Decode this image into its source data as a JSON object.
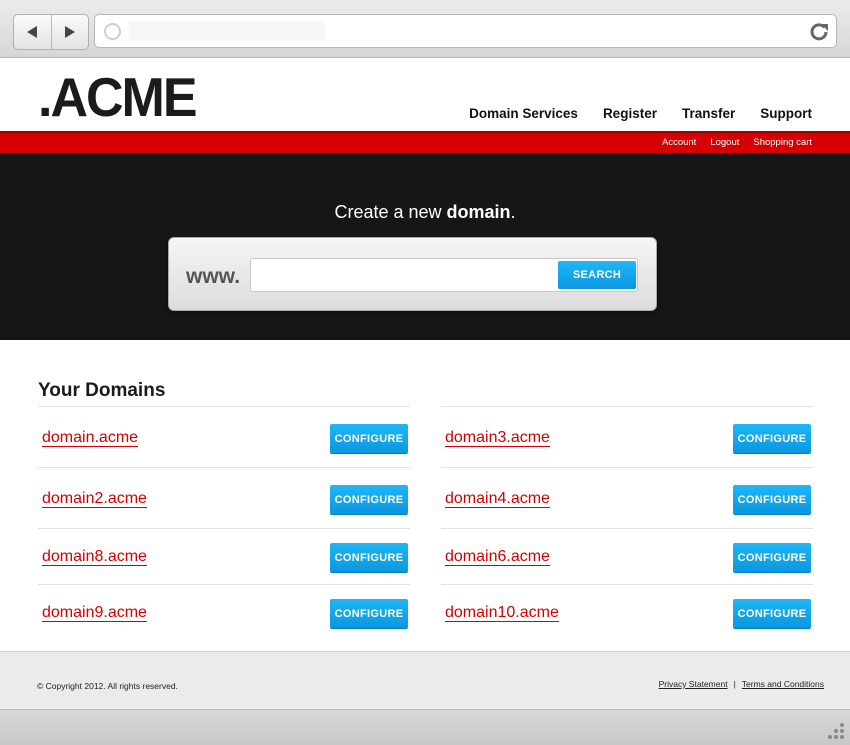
{
  "browser": {
    "back_icon": "back-arrow-icon",
    "forward_icon": "forward-arrow-icon",
    "reload_icon": "reload-icon",
    "address_value": ""
  },
  "header": {
    "logo": ".ACME",
    "nav": [
      "Domain Services",
      "Register",
      "Transfer",
      "Support"
    ],
    "subnav": [
      "Account",
      "Logout",
      "Shopping cart"
    ]
  },
  "hero": {
    "title_prefix": "Create a new ",
    "title_bold": "domain",
    "title_suffix": ".",
    "www_label": "www.",
    "search_value": "",
    "search_button": "SEARCH"
  },
  "domains": {
    "title": "Your Domains",
    "configure_label": "CONFIGURE",
    "left": [
      "domain.acme",
      "domain2.acme",
      "domain8.acme",
      "domain9.acme"
    ],
    "right": [
      "domain3.acme",
      "domain4.acme",
      "domain6.acme",
      "domain10.acme"
    ]
  },
  "footer": {
    "copyright": "© Copyright 2012. All rights reserved.",
    "privacy": "Privacy Statement",
    "separator": "|",
    "terms": "Terms and Conditions"
  },
  "colors": {
    "brand_red": "#d60000",
    "button_blue": "#0ea6ea",
    "hero_bg": "#161616"
  }
}
